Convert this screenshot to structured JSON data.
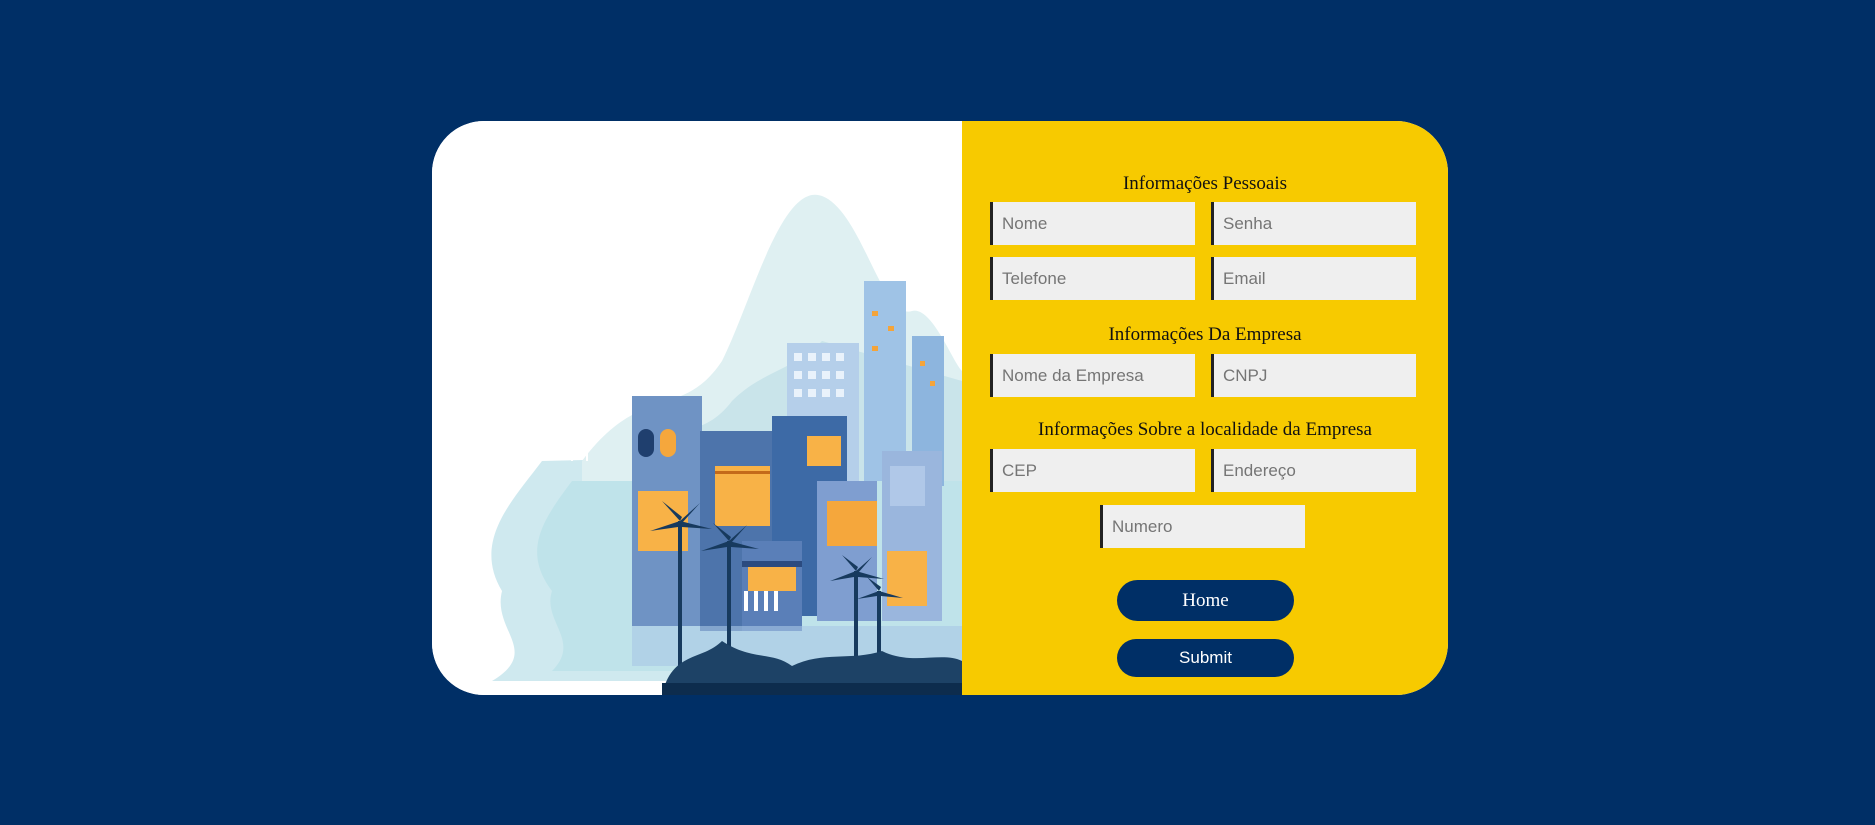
{
  "sections": {
    "personal_title": "Informações Pessoais",
    "company_title": "Informações Da Empresa",
    "location_title": "Informações Sobre a localidade da Empresa"
  },
  "fields": {
    "nome": "Nome",
    "senha": "Senha",
    "telefone": "Telefone",
    "email": "Email",
    "nome_empresa": "Nome da Empresa",
    "cnpj": "CNPJ",
    "cep": "CEP",
    "endereco": "Endereço",
    "numero": "Numero"
  },
  "buttons": {
    "home": "Home",
    "submit": "Submit"
  },
  "colors": {
    "background": "#002f66",
    "form_panel": "#f7ca00",
    "button": "#002f66",
    "field_bg": "#efefef"
  }
}
